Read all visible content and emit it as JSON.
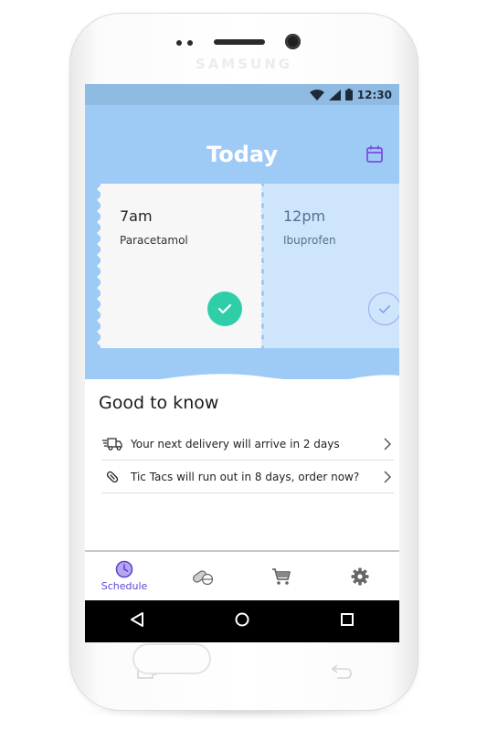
{
  "device": {
    "brand": "SAMSUNG"
  },
  "status_bar": {
    "time": "12:30"
  },
  "header": {
    "title": "Today"
  },
  "doses": [
    {
      "time": "7am",
      "medication": "Paracetamol",
      "taken": true
    },
    {
      "time": "12pm",
      "medication": "Ibuprofen",
      "taken": false
    }
  ],
  "good_to_know": {
    "title": "Good to know",
    "items": [
      {
        "icon": "delivery-truck-icon",
        "text": "Your next delivery will arrive in 2 days"
      },
      {
        "icon": "pill-icon",
        "text": "Tic Tacs will run out in 8 days, order now?"
      }
    ]
  },
  "bottom_nav": {
    "items": [
      {
        "icon": "clock-icon",
        "label": "Schedule",
        "active": true
      },
      {
        "icon": "pills-icon",
        "label": "",
        "active": false
      },
      {
        "icon": "cart-icon",
        "label": "",
        "active": false
      },
      {
        "icon": "gear-icon",
        "label": "",
        "active": false
      }
    ]
  },
  "colors": {
    "hero": "#9dcbf6",
    "status_bar": "#8fbbe3",
    "accent_purple": "#5a48d6",
    "check_green": "#2fcea9"
  }
}
